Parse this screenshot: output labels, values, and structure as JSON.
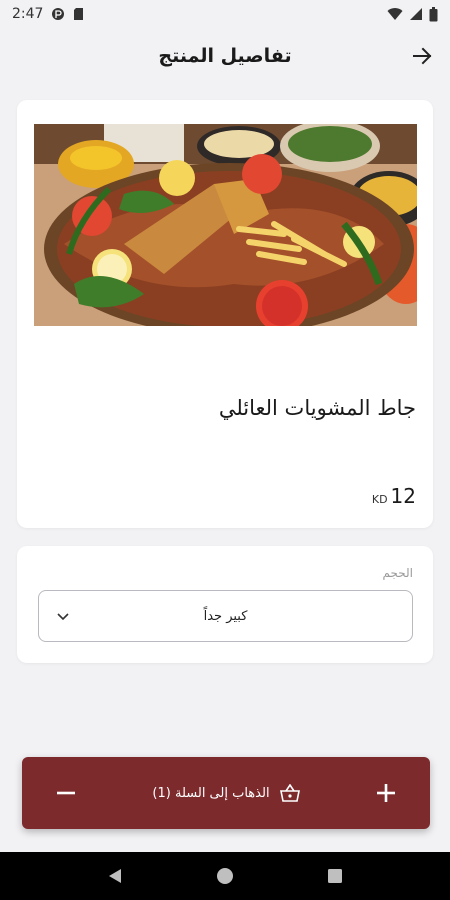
{
  "status_bar": {
    "time": "2:47"
  },
  "header": {
    "title": "تفاصيل المنتج"
  },
  "product": {
    "name": "جاط المشويات العائلي",
    "price": "12",
    "currency": "KD"
  },
  "options": {
    "size_label": "الحجم",
    "size_value": "كبير جداً"
  },
  "cart": {
    "label": "الذهاب إلى السلة (1)",
    "plus": "+",
    "minus": "−"
  },
  "colors": {
    "accent": "#7d2a2d",
    "background": "#f2f2f4"
  },
  "icons": [
    "back-arrow-icon",
    "chevron-down-icon",
    "basket-icon",
    "plus-icon",
    "minus-icon",
    "wifi-icon",
    "battery-icon"
  ]
}
